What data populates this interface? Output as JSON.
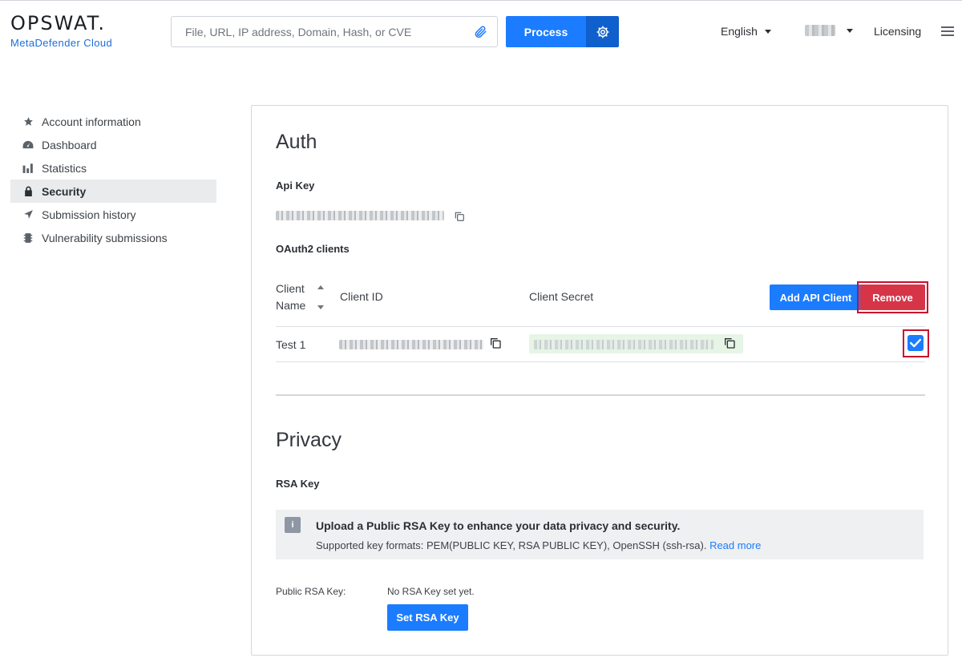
{
  "brand": {
    "name": "OPSWAT.",
    "product": "MetaDefender Cloud"
  },
  "search": {
    "placeholder": "File, URL, IP address, Domain, Hash, or CVE"
  },
  "process": {
    "label": "Process"
  },
  "nav": {
    "language": "English",
    "licensing": "Licensing"
  },
  "sidebar": {
    "items": [
      {
        "label": "Account information",
        "icon": "star-icon"
      },
      {
        "label": "Dashboard",
        "icon": "dashboard-icon"
      },
      {
        "label": "Statistics",
        "icon": "bar-chart-icon"
      },
      {
        "label": "Security",
        "icon": "lock-icon",
        "active": true
      },
      {
        "label": "Submission history",
        "icon": "location-arrow-icon"
      },
      {
        "label": "Vulnerability submissions",
        "icon": "chip-icon"
      }
    ]
  },
  "auth": {
    "title": "Auth",
    "api_key_label": "Api Key",
    "oauth_label": "OAuth2 clients",
    "table": {
      "headers": {
        "client_name_line1": "Client",
        "client_name_line2": "Name",
        "client_id": "Client ID",
        "client_secret": "Client Secret"
      },
      "rows": [
        {
          "name": "Test 1",
          "checked": true
        }
      ]
    },
    "add_button": "Add API Client",
    "remove_button": "Remove"
  },
  "privacy": {
    "title": "Privacy",
    "rsa_label": "RSA Key",
    "info_icon": "i",
    "info_title": "Upload a Public RSA Key to enhance your data privacy and security.",
    "info_sub": "Supported key formats: PEM(PUBLIC KEY, RSA PUBLIC KEY), OpenSSH (ssh-rsa).",
    "info_link": "Read more",
    "public_key_label": "Public RSA Key:",
    "public_key_value": "No RSA Key set yet.",
    "set_button": "Set RSA Key"
  },
  "colors": {
    "primary": "#1b7cff",
    "danger": "#d63548",
    "highlight": "#c8102e"
  }
}
